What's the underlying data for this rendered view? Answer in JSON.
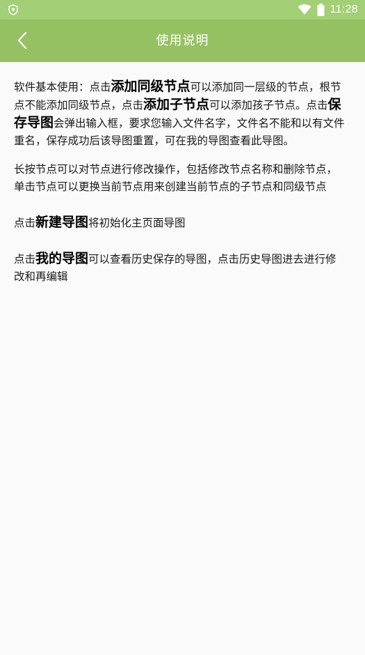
{
  "status_bar": {
    "time": "11:28",
    "icons": [
      "shield-icon",
      "wifi-icon",
      "battery-icon"
    ]
  },
  "app_bar": {
    "title": "使用说明",
    "back_icon": "chevron-left-icon"
  },
  "colors": {
    "status_bar": "#a3cf76",
    "app_bar": "#96c162",
    "background": "#fafafa",
    "text": "#1a1a1a"
  },
  "content": {
    "p1": {
      "t1": "软件基本使用：点击",
      "b1": "添加同级节点",
      "t2": "可以添加同一层级的节点，根节点不能添加同级节点，点击",
      "b2": "添加子节点",
      "t3": "可以添加孩子节点。点击",
      "b3": "保存导图",
      "t4": "会弹出输入框，要求您输入文件名字，文件名不能和以有文件重名，保存成功后该导图重置，可在我的导图查看此导图。"
    },
    "p2": {
      "t1": "长按节点可以对节点进行修改操作，包括修改节点名称和删除节点，单击节点可以更换当前节点用来创建当前节点的子节点和同级节点"
    },
    "p3": {
      "t1": "点击",
      "b1": "新建导图",
      "t2": "将初始化主页面导图"
    },
    "p4": {
      "t1": "点击",
      "b1": "我的导图",
      "t2": "可以查看历史保存的导图，点击历史导图进去进行修改和再编辑"
    }
  }
}
